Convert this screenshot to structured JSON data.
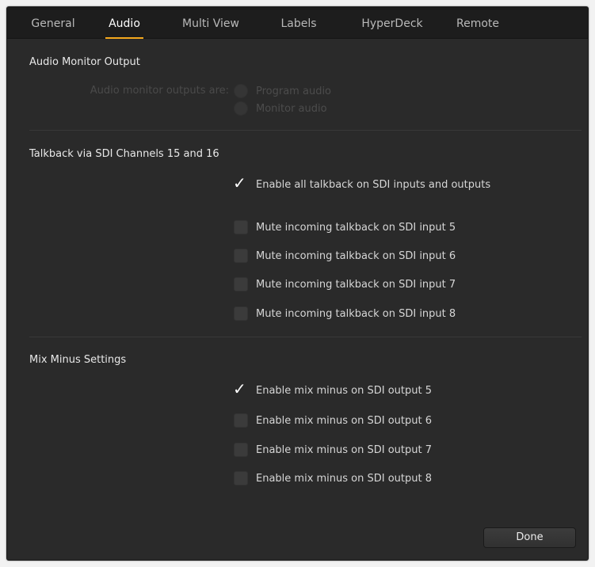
{
  "tabs": [
    {
      "label": "General"
    },
    {
      "label": "Audio"
    },
    {
      "label": "Multi View"
    },
    {
      "label": "Labels"
    },
    {
      "label": "HyperDeck"
    },
    {
      "label": "Remote"
    }
  ],
  "active_tab": "Audio",
  "accent_color": "#f5a81c",
  "audio_monitor": {
    "title": "Audio Monitor Output",
    "outputs_label": "Audio monitor outputs are:",
    "options": [
      {
        "label": "Program audio",
        "selected": false,
        "enabled": false
      },
      {
        "label": "Monitor audio",
        "selected": false,
        "enabled": false
      }
    ]
  },
  "talkback": {
    "title": "Talkback via SDI Channels 15 and 16",
    "enable_all": {
      "label": "Enable all talkback on SDI inputs and outputs",
      "checked": true
    },
    "mute_items": [
      {
        "label": "Mute incoming talkback on SDI input 5",
        "checked": false
      },
      {
        "label": "Mute incoming talkback on SDI input 6",
        "checked": false
      },
      {
        "label": "Mute incoming talkback on SDI input 7",
        "checked": false
      },
      {
        "label": "Mute incoming talkback on SDI input 8",
        "checked": false
      }
    ]
  },
  "mix_minus": {
    "title": "Mix Minus Settings",
    "items": [
      {
        "label": "Enable mix minus on SDI output 5",
        "checked": true
      },
      {
        "label": "Enable mix minus on SDI output 6",
        "checked": false
      },
      {
        "label": "Enable mix minus on SDI output 7",
        "checked": false
      },
      {
        "label": "Enable mix minus on SDI output 8",
        "checked": false
      }
    ]
  },
  "done_label": "Done"
}
